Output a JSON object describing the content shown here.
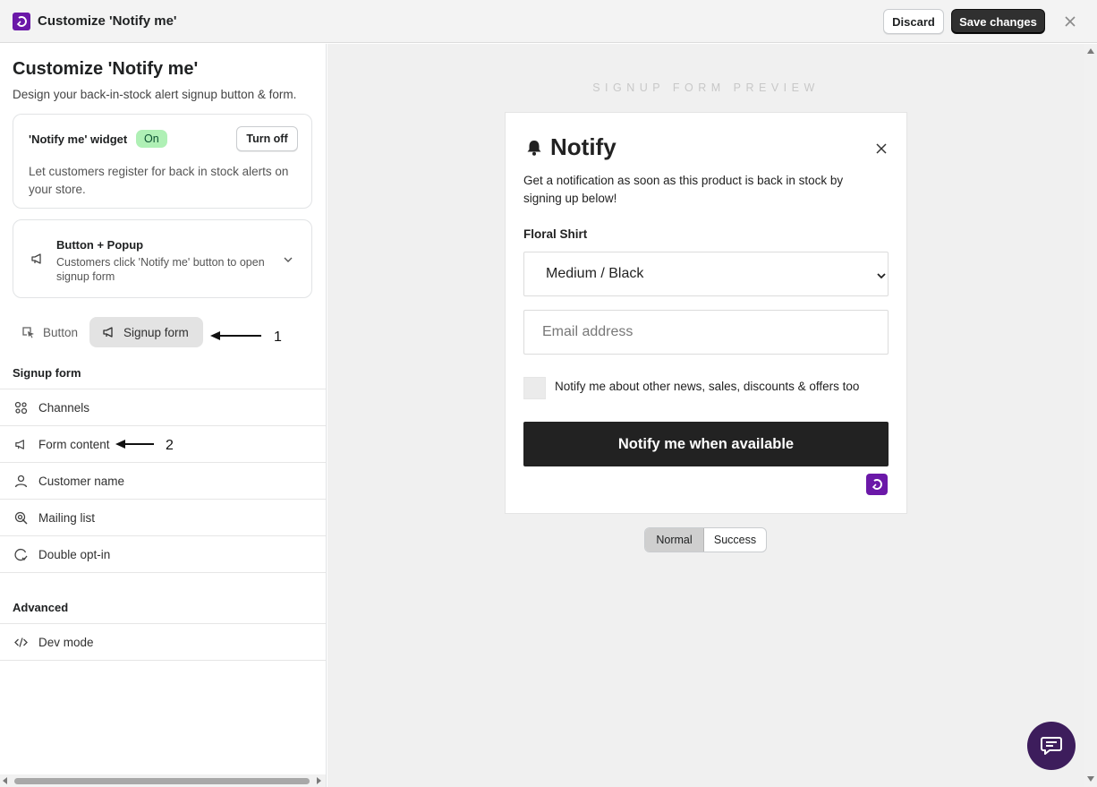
{
  "window": {
    "title": "Customize 'Notify me'",
    "discard_label": "Discard",
    "save_label": "Save changes",
    "accent_color": "#6b18a8"
  },
  "sidebar": {
    "title": "Customize 'Notify me'",
    "subtitle": "Design your back-in-stock alert signup button & form.",
    "widget": {
      "label": "'Notify me' widget",
      "status": "On",
      "toggle_label": "Turn off",
      "description": "Let customers register for back in stock alerts on your store."
    },
    "mode": {
      "title": "Button + Popup",
      "description": "Customers click 'Notify me' button to open signup form"
    },
    "tabs": [
      {
        "label": "Button",
        "icon": "cursor-click-icon"
      },
      {
        "label": "Signup form",
        "icon": "megaphone-icon",
        "active": true
      }
    ],
    "annotations": [
      "1",
      "2"
    ],
    "signup_section": {
      "label": "Signup form",
      "items": [
        {
          "label": "Channels",
          "icon": "channels-icon"
        },
        {
          "label": "Form content",
          "icon": "megaphone-icon"
        },
        {
          "label": "Customer name",
          "icon": "person-icon"
        },
        {
          "label": "Mailing list",
          "icon": "mailing-list-icon"
        },
        {
          "label": "Double opt-in",
          "icon": "double-optin-icon"
        }
      ]
    },
    "advanced_section": {
      "label": "Advanced",
      "items": [
        {
          "label": "Dev mode",
          "icon": "code-icon"
        }
      ]
    }
  },
  "preview": {
    "heading": "SIGNUP FORM PREVIEW",
    "form": {
      "title": "Notify",
      "description": "Get a notification as soon as this product is back in stock by signing up below!",
      "product_name": "Floral Shirt",
      "variant_value": "Medium / Black",
      "email_placeholder": "Email address",
      "opt_in_label": "Notify me about other news, sales, discounts & offers too",
      "submit_label": "Notify me when available"
    },
    "states": [
      {
        "label": "Normal",
        "active": true
      },
      {
        "label": "Success",
        "active": false
      }
    ]
  }
}
